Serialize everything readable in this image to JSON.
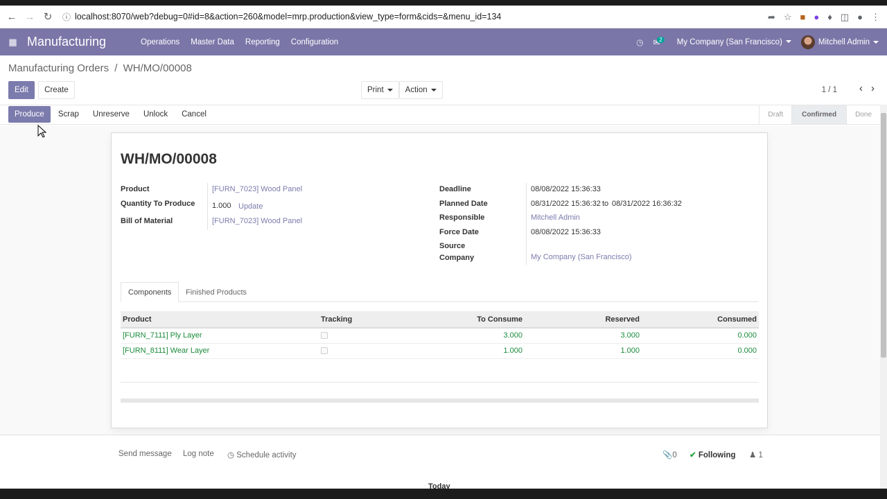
{
  "browser": {
    "url": "localhost:8070/web?debug=0#id=8&action=260&model=mrp.production&view_type=form&cids=&menu_id=134"
  },
  "navbar": {
    "app_name": "Manufacturing",
    "menu": [
      "Operations",
      "Master Data",
      "Reporting",
      "Configuration"
    ],
    "message_count": "2",
    "company": "My Company (San Francisco)",
    "user": "Mitchell Admin",
    "color": "#7a76a8"
  },
  "breadcrumb": {
    "parent": "Manufacturing Orders",
    "separator": "/",
    "current": "WH/MO/00008"
  },
  "control_panel": {
    "edit": "Edit",
    "create": "Create",
    "print": "Print",
    "action": "Action",
    "pager": "1 / 1"
  },
  "statusbar": {
    "buttons": [
      "Produce",
      "Scrap",
      "Unreserve",
      "Unlock",
      "Cancel"
    ],
    "stages": [
      "Draft",
      "Confirmed",
      "Done"
    ],
    "active_stage": "Confirmed"
  },
  "form": {
    "title": "WH/MO/00008",
    "left_fields": {
      "product_label": "Product",
      "product_value": "[FURN_7023] Wood Panel",
      "qty_label": "Quantity To Produce",
      "qty_value": "1.000",
      "qty_update": "Update",
      "bom_label": "Bill of Material",
      "bom_value": "[FURN_7023] Wood Panel"
    },
    "right_fields": {
      "deadline_label": "Deadline",
      "deadline_value": "08/08/2022 15:36:33",
      "planned_label": "Planned Date",
      "planned_start": "08/31/2022 15:36:32",
      "planned_to": "to",
      "planned_end": "08/31/2022 16:36:32",
      "responsible_label": "Responsible",
      "responsible_value": "Mitchell Admin",
      "force_label": "Force Date",
      "force_value": "08/08/2022 15:36:33",
      "source_label_1": "Source",
      "source_label_2": "Company",
      "company_value": "My Company (San Francisco)"
    },
    "tabs": [
      "Components",
      "Finished Products"
    ],
    "table": {
      "columns": [
        "Product",
        "Tracking",
        "To Consume",
        "Reserved",
        "Consumed"
      ],
      "rows": [
        {
          "product": "[FURN_7111] Ply Layer",
          "to_consume": "3.000",
          "reserved": "3.000",
          "consumed": "0.000"
        },
        {
          "product": "[FURN_8111] Wear Layer",
          "to_consume": "1.000",
          "reserved": "1.000",
          "consumed": "0.000"
        }
      ]
    }
  },
  "chatter": {
    "send_message": "Send message",
    "log_note": "Log note",
    "schedule_activity": "Schedule activity",
    "attachments": "0",
    "following": "Following",
    "followers": "1",
    "today": "Today"
  }
}
